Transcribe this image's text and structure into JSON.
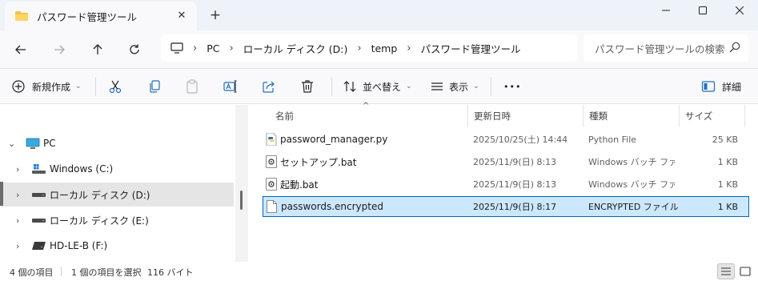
{
  "tab": {
    "title": "パスワード管理ツール"
  },
  "address": {
    "crumbs": [
      "PC",
      "ローカル ディスク (D:)",
      "temp",
      "パスワード管理ツール"
    ]
  },
  "search": {
    "placeholder": "パスワード管理ツールの検索"
  },
  "toolbar": {
    "new_label": "新規作成",
    "sort_label": "並べ替え",
    "view_label": "表示",
    "more_label": "•••",
    "details_label": "詳細"
  },
  "navpane": {
    "items": [
      {
        "label": "PC"
      },
      {
        "label": "Windows (C:)"
      },
      {
        "label": "ローカル ディスク (D:)"
      },
      {
        "label": "ローカル ディスク (E:)"
      },
      {
        "label": "HD-LE-B (F:)"
      }
    ]
  },
  "columns": {
    "name": "名前",
    "date": "更新日時",
    "type": "種類",
    "size": "サイズ"
  },
  "files": [
    {
      "name": "password_manager.py",
      "date": "2025/10/25(土) 14:44",
      "type": "Python File",
      "size": "25 KB",
      "icon": "python-file-icon"
    },
    {
      "name": "セットアップ.bat",
      "date": "2025/11/9(日) 8:13",
      "type": "Windows バッチ ファ...",
      "size": "1 KB",
      "icon": "batch-file-icon"
    },
    {
      "name": "起動.bat",
      "date": "2025/11/9(日) 8:13",
      "type": "Windows バッチ ファ...",
      "size": "1 KB",
      "icon": "batch-file-icon"
    },
    {
      "name": "passwords.encrypted",
      "date": "2025/11/9(日) 8:17",
      "type": "ENCRYPTED ファイル",
      "size": "1 KB",
      "icon": "file-icon",
      "selected": true
    }
  ],
  "status": {
    "count": "4 個の項目",
    "selection": "1 個の項目を選択",
    "selection_size": "116 バイト"
  },
  "colors": {
    "accent": "#0067c0",
    "selection": "#cce8ff",
    "folder": "#f5c44e"
  }
}
